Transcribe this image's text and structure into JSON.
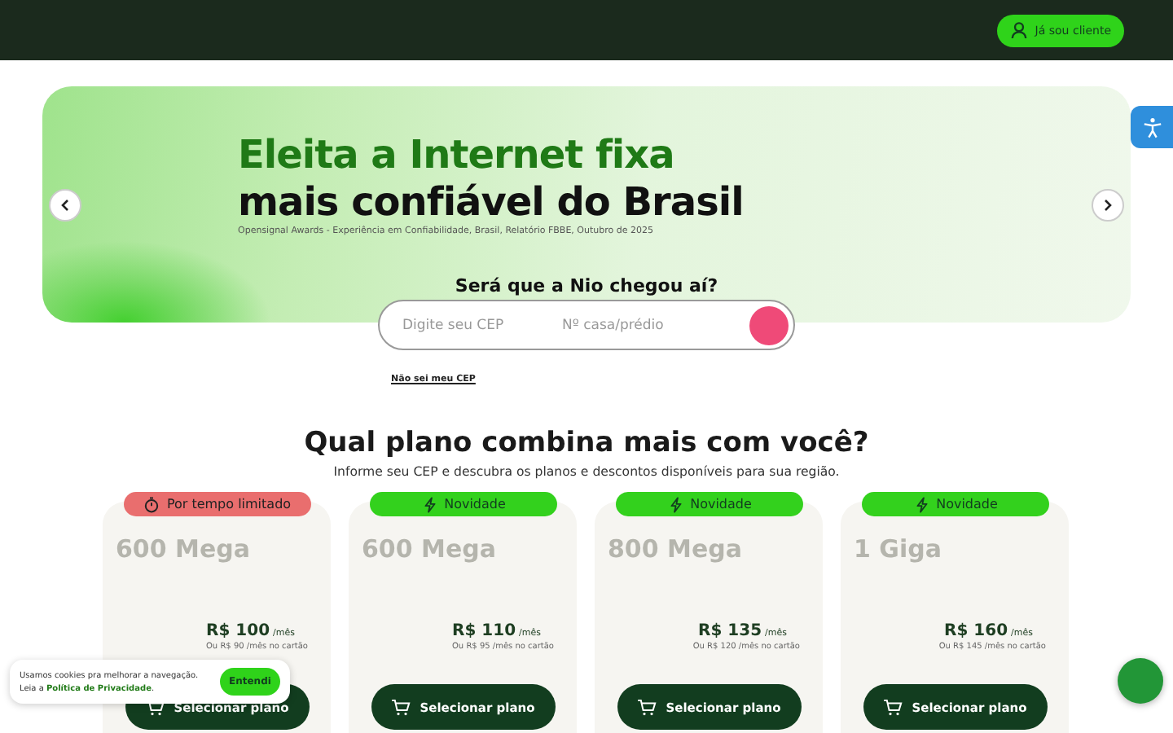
{
  "header": {
    "client_button": "Já sou cliente"
  },
  "hero": {
    "title_line_1": "Eleita a Internet fixa",
    "title_line_2": "mais confiável do Brasil",
    "source": "Opensignal Awards - Experiência em Confiabilidade, Brasil, Relatório FBBE, Outubro de 2025"
  },
  "coverage": {
    "question": "Será que a Nio chegou aí?",
    "cep_field": {
      "placeholder": "Digite seu CEP"
    },
    "number_field": {
      "placeholder": "Nº casa/prédio"
    },
    "unknown_cep_link": "Não sei meu CEP"
  },
  "plans_section": {
    "heading": "Qual plano combina mais com você?",
    "subheading": "Informe seu CEP e descubra os planos e descontos disponíveis para sua região."
  },
  "plans": [
    {
      "badge": {
        "kind": "limited",
        "label": "Por tempo limitado"
      },
      "speed": "600 Mega",
      "price": "R$ 100",
      "period": "/mês",
      "card_price": "Ou R$ 90 /mês no cartão",
      "button": "Selecionar plano"
    },
    {
      "badge": {
        "kind": "new",
        "label": "Novidade"
      },
      "speed": "600 Mega",
      "price": "R$ 110",
      "period": "/mês",
      "card_price": "Ou R$ 95 /mês no cartão",
      "button": "Selecionar plano"
    },
    {
      "badge": {
        "kind": "new",
        "label": "Novidade"
      },
      "speed": "800 Mega",
      "price": "R$ 135",
      "period": "/mês",
      "card_price": "Ou R$ 120 /mês no cartão",
      "button": "Selecionar plano"
    },
    {
      "badge": {
        "kind": "new",
        "label": "Novidade"
      },
      "speed": "1 Giga",
      "price": "R$ 160",
      "period": "/mês",
      "card_price": "Ou R$ 145 /mês no cartão",
      "button": "Selecionar plano"
    }
  ],
  "cookie_banner": {
    "text_before": "Usamos cookies pra melhorar a navegação. Leia a",
    "link": "Política de Privacidade",
    "text_after": ".",
    "button": "Entendi"
  }
}
